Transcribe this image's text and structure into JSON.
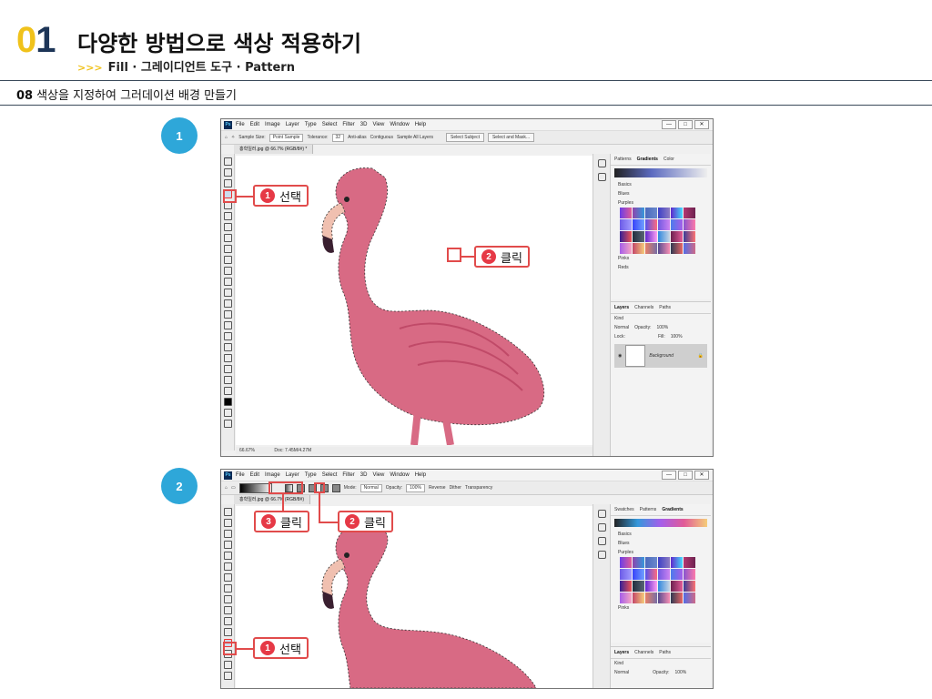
{
  "header": {
    "chapter_num_first": "0",
    "chapter_num_second": "1",
    "title": "다양한 방법으로 색상 적용하기",
    "sub_arrow": ">>>",
    "subtitle": "Fill · 그레이디언트 도구 · Pattern",
    "section_num": "08",
    "section_title": "색상을 지정하여 그러데이션 배경 만들기"
  },
  "steps": [
    "1",
    "2"
  ],
  "menu": [
    "File",
    "Edit",
    "Image",
    "Layer",
    "Type",
    "Select",
    "Filter",
    "3D",
    "View",
    "Window",
    "Help"
  ],
  "window_buttons": [
    "—",
    "□",
    "✕"
  ],
  "ps_logo": "Ps",
  "shot1": {
    "options": {
      "sample_size_label": "Sample Size:",
      "sample_size_value": "Point Sample",
      "tolerance_label": "Tolerance:",
      "tolerance_value": "32",
      "antialias": "Anti-alias",
      "contiguous": "Contiguous",
      "sample_all": "Sample All Layers",
      "select_subject": "Select Subject",
      "select_mask": "Select and Mask..."
    },
    "doc_tab": "홍학일러.jpg @ 66.7% (RGB/8#) *",
    "status_zoom": "66.67%",
    "status_doc": "Doc: 7.45M/4.27M",
    "panel_tabs": [
      "Patterns",
      "Gradients",
      "Color"
    ],
    "folders": [
      "Basics",
      "Blues",
      "Purples",
      "Pinks",
      "Reds"
    ],
    "layer_tabs": [
      "Layers",
      "Channels",
      "Paths"
    ],
    "layer_kind": "Kind",
    "blend_mode": "Normal",
    "opacity_label": "Opacity:",
    "opacity_value": "100%",
    "lock_label": "Lock:",
    "fill_label": "Fill:",
    "fill_value": "100%",
    "layer_name": "Background",
    "callout1_num": "1",
    "callout1_text": "선택",
    "callout2_num": "2",
    "callout2_text": "클릭"
  },
  "shot2": {
    "options": {
      "mode_label": "Mode:",
      "mode_value": "Normal",
      "opacity_label": "Opacity:",
      "opacity_value": "100%",
      "reverse": "Reverse",
      "dither": "Dither",
      "transparency": "Transparency"
    },
    "doc_tab": "홍학일러.jpg @ 66.7% (RGB/8#)",
    "panel_tabs": [
      "Swatches",
      "Patterns",
      "Gradients"
    ],
    "folders": [
      "Basics",
      "Blues",
      "Purples",
      "Pinks"
    ],
    "layer_tabs": [
      "Layers",
      "Channels",
      "Paths"
    ],
    "layer_kind": "Kind",
    "blend_mode": "Normal",
    "opacity_label": "Opacity:",
    "opacity_value": "100%",
    "callout3_num": "3",
    "callout3_text": "클릭",
    "callout2_num": "2",
    "callout2_text": "클릭",
    "callout1_num": "1",
    "callout1_text": "선택"
  },
  "colors": {
    "accent_yellow": "#f0c21b",
    "accent_navy": "#1d3557",
    "step_blue": "#2ea7d9",
    "callout_red": "#e14b4b",
    "flamingo": "#d86a84"
  }
}
